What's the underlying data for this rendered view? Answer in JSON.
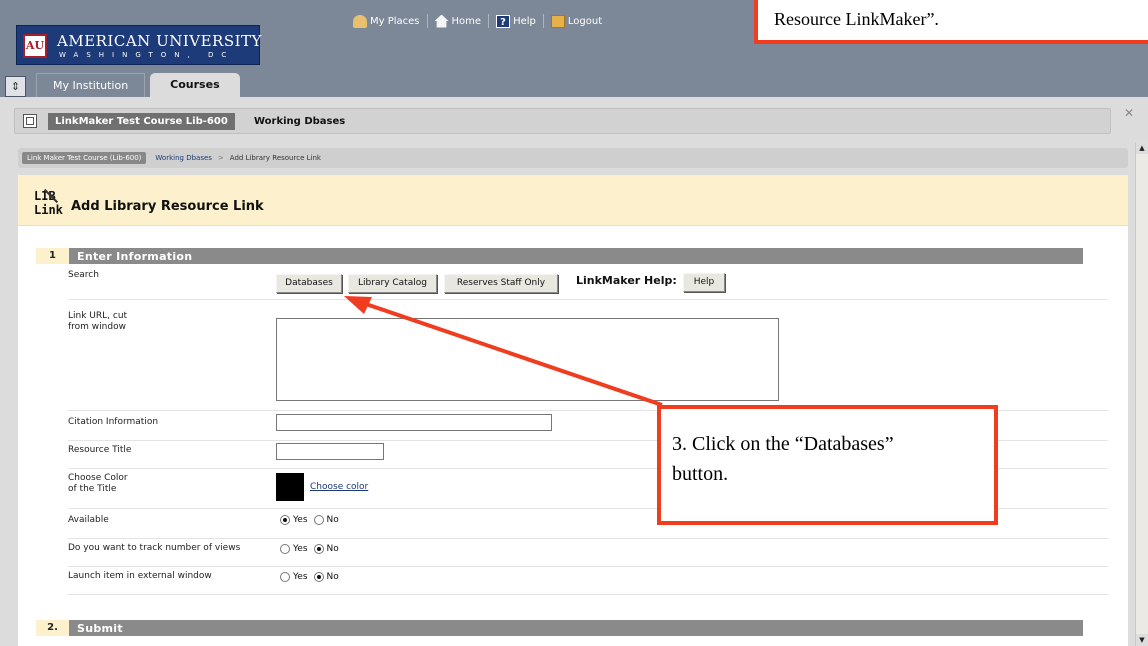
{
  "header": {
    "logo": {
      "name": "AMERICAN UNIVERSITY",
      "city": "WASHINGTON, DC"
    },
    "top_links": [
      {
        "label": "My Places",
        "icon": "places-icon"
      },
      {
        "label": "Home",
        "icon": "home-icon"
      },
      {
        "label": "Help",
        "icon": "help-icon"
      },
      {
        "label": "Logout",
        "icon": "logout-icon"
      }
    ],
    "tabs": [
      {
        "label": "My Institution",
        "active": false
      },
      {
        "label": "Courses",
        "active": true
      }
    ]
  },
  "course_bar": {
    "course": "LinkMaker Test Course Lib-600",
    "area": "Working Dbases"
  },
  "breadcrumb": {
    "course": "Link Maker Test Course (Lib-600)",
    "area": "Working Dbases",
    "current": "Add Library Resource Link"
  },
  "page": {
    "icon_text": "LIB Link",
    "title": "Add Library Resource Link"
  },
  "sections": [
    {
      "number": "1",
      "label": "Enter Information"
    },
    {
      "number": "2.",
      "label": "Submit"
    }
  ],
  "form": {
    "search": {
      "label": "Search",
      "buttons": [
        "Databases",
        "Library Catalog",
        "Reserves Staff Only"
      ],
      "help_label": "LinkMaker Help:",
      "help_button": "Help"
    },
    "link_url": {
      "label_line1": "Link URL, cut",
      "label_line2": "from window",
      "value": ""
    },
    "citation": {
      "label": "Citation Information",
      "value": ""
    },
    "resource_title": {
      "label": "Resource Title",
      "value": ""
    },
    "title_color": {
      "label_line1": "Choose Color",
      "label_line2": "of the Title",
      "link": "Choose color",
      "color": "#000000"
    },
    "available": {
      "label": "Available",
      "yes": "Yes",
      "no": "No",
      "selected": "Yes"
    },
    "track_views": {
      "label": "Do you want to track number of views",
      "yes": "Yes",
      "no": "No",
      "selected": "No"
    },
    "external_window": {
      "label": "Launch item in external window",
      "yes": "Yes",
      "no": "No",
      "selected": "No"
    }
  },
  "annotations": {
    "top_callout": "Resource LinkMaker”.",
    "main_callout_line1": "3. Click on the “Databases”",
    "main_callout_line2": "button.",
    "color": "#f03c1f"
  },
  "colors": {
    "header": "#7c8897",
    "logo": "#1d3a79",
    "page_header": "#fcf1cc",
    "section_bar": "#8a8a8a"
  }
}
